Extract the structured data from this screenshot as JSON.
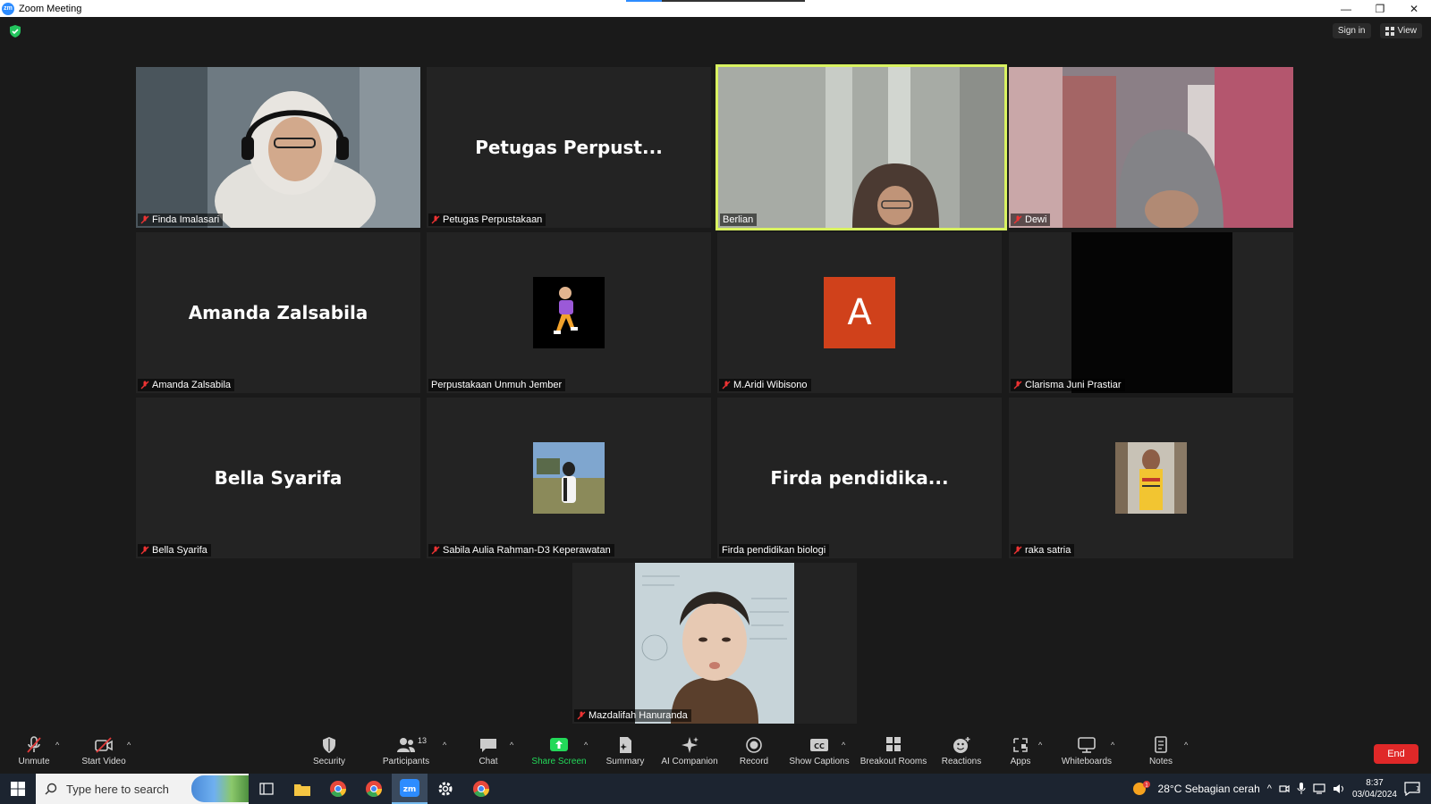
{
  "window": {
    "title": "Zoom Meeting",
    "logo_text": "zm",
    "controls": [
      "—",
      "❐",
      "✕"
    ]
  },
  "top_controls": {
    "sign_in": "Sign in",
    "view": "View"
  },
  "tiles": [
    {
      "name": "Finda Imalasari",
      "big": "",
      "muted": true
    },
    {
      "name": "Petugas Perpustakaan",
      "big": "Petugas  Perpust...",
      "muted": true
    },
    {
      "name": "Berlian",
      "big": "",
      "muted": false,
      "active": true
    },
    {
      "name": "Dewi",
      "big": "",
      "muted": true
    },
    {
      "name": "Amanda Zalsabila",
      "big": "Amanda Zalsabila",
      "muted": true
    },
    {
      "name": "Perpustakaan Unmuh Jember",
      "big": "",
      "muted": false
    },
    {
      "name": "M.Aridi Wibisono",
      "big": "",
      "muted": true,
      "letter": "A"
    },
    {
      "name": "Clarisma Juni Prastiar",
      "big": "",
      "muted": true
    },
    {
      "name": "Bella Syarifa",
      "big": "Bella Syarifa",
      "muted": true
    },
    {
      "name": "Sabila Aulia Rahman-D3 Keperawatan",
      "big": "",
      "muted": true
    },
    {
      "name": "Firda pendidikan biologi",
      "big": "Firda  pendidika...",
      "muted": false
    },
    {
      "name": "raka satria",
      "big": "",
      "muted": true
    },
    {
      "name": "Mazdalifah Hanuranda",
      "big": "",
      "muted": true
    }
  ],
  "toolbar": {
    "unmute": "Unmute",
    "start_video": "Start Video",
    "security": "Security",
    "participants": "Participants",
    "participants_count": "13",
    "chat": "Chat",
    "share_screen": "Share Screen",
    "summary": "Summary",
    "ai_companion": "AI Companion",
    "record": "Record",
    "show_captions": "Show Captions",
    "breakout_rooms": "Breakout Rooms",
    "reactions": "Reactions",
    "apps": "Apps",
    "whiteboards": "Whiteboards",
    "notes": "Notes",
    "end": "End",
    "accent_green": "#23d959",
    "end_color": "#e02828",
    "speaker_border": "#d9f261"
  },
  "taskbar": {
    "search_placeholder": "Type here to search",
    "weather": "28°C  Sebagian cerah",
    "time": "8:37",
    "date": "03/04/2024",
    "notification_count": "1",
    "weather_alert": "1"
  }
}
